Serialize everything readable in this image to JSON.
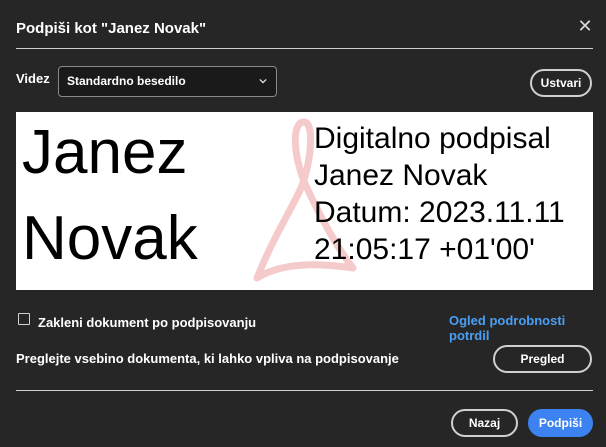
{
  "dialog": {
    "title": "Podpiši kot \"Janez Novak\"",
    "close_icon": "close-icon"
  },
  "appearance": {
    "style_label": "Videz",
    "style_value": "Standardno besedilo",
    "create_label": "Ustvari"
  },
  "preview": {
    "name_line1": "Janez",
    "name_line2": "Novak",
    "details": [
      "Digitalno podpisal",
      "Janez Novak",
      "Datum: 2023.11.11",
      "21:05:17 +01'00'"
    ],
    "watermark_icon": "acrobat-logo-watermark",
    "watermark_color": "#f2b8b8"
  },
  "options": {
    "lock_checked": false,
    "lock_label": "Zakleni dokument po podpisovanju",
    "cert_link": "Ogled podrobnosti potrdil"
  },
  "review": {
    "text": "Preglejte vsebino dokumenta, ki lahko vpliva na podpisovanje",
    "button_label": "Pregled"
  },
  "footer": {
    "back_label": "Nazaj",
    "sign_label": "Podpiši"
  },
  "colors": {
    "background": "#262626",
    "accent": "#3c82f0",
    "link": "#4a9ff5"
  }
}
